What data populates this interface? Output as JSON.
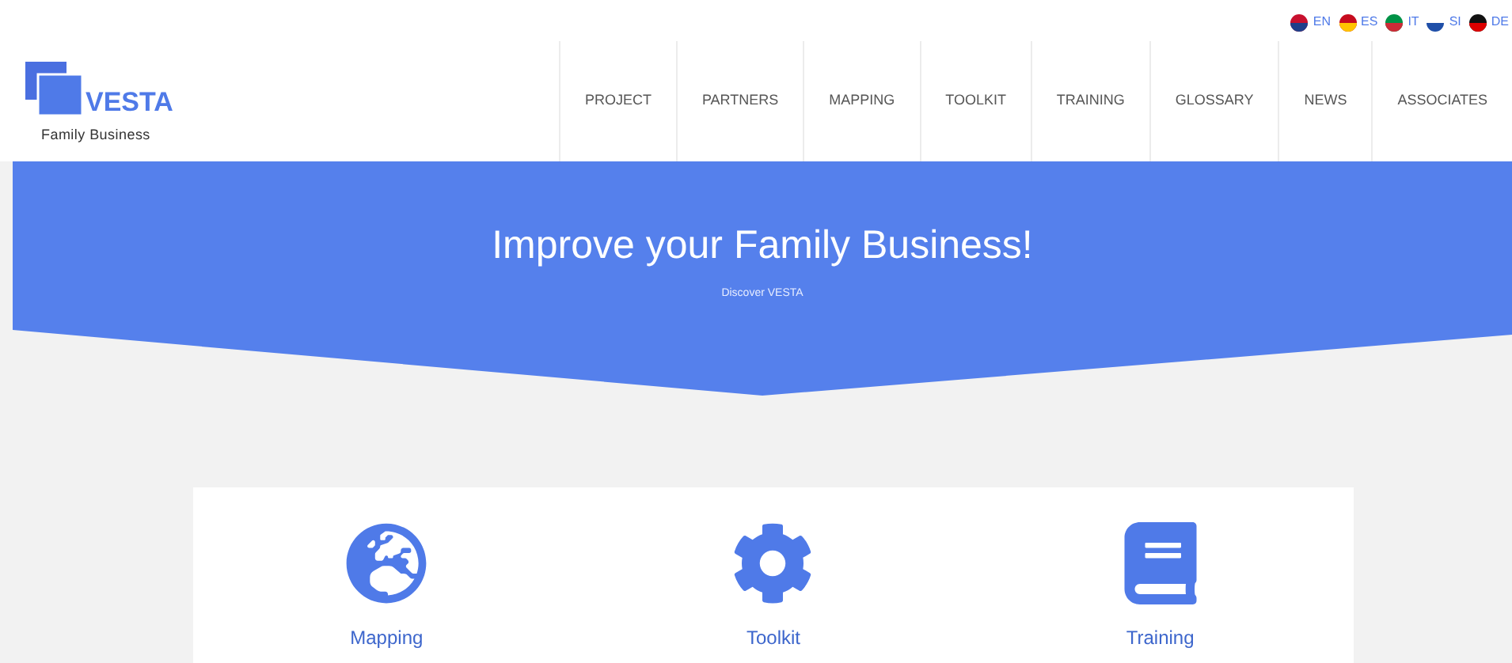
{
  "logo": {
    "name": "VESTA",
    "tagline": "Family Business"
  },
  "languages": [
    {
      "kind": "uk",
      "code": "EN"
    },
    {
      "kind": "es",
      "code": "ES"
    },
    {
      "kind": "it",
      "code": "IT"
    },
    {
      "kind": "si",
      "code": "SI"
    },
    {
      "kind": "de",
      "code": "DE"
    }
  ],
  "nav": [
    "PROJECT",
    "PARTNERS",
    "MAPPING",
    "TOOLKIT",
    "TRAINING",
    "GLOSSARY",
    "NEWS",
    "ASSOCIATES"
  ],
  "hero": {
    "title": "Improve your Family Business!",
    "subtitle": "Discover VESTA"
  },
  "features": [
    {
      "kind": "globe",
      "label": "Mapping"
    },
    {
      "kind": "gear",
      "label": "Toolkit"
    },
    {
      "kind": "book",
      "label": "Training"
    }
  ]
}
